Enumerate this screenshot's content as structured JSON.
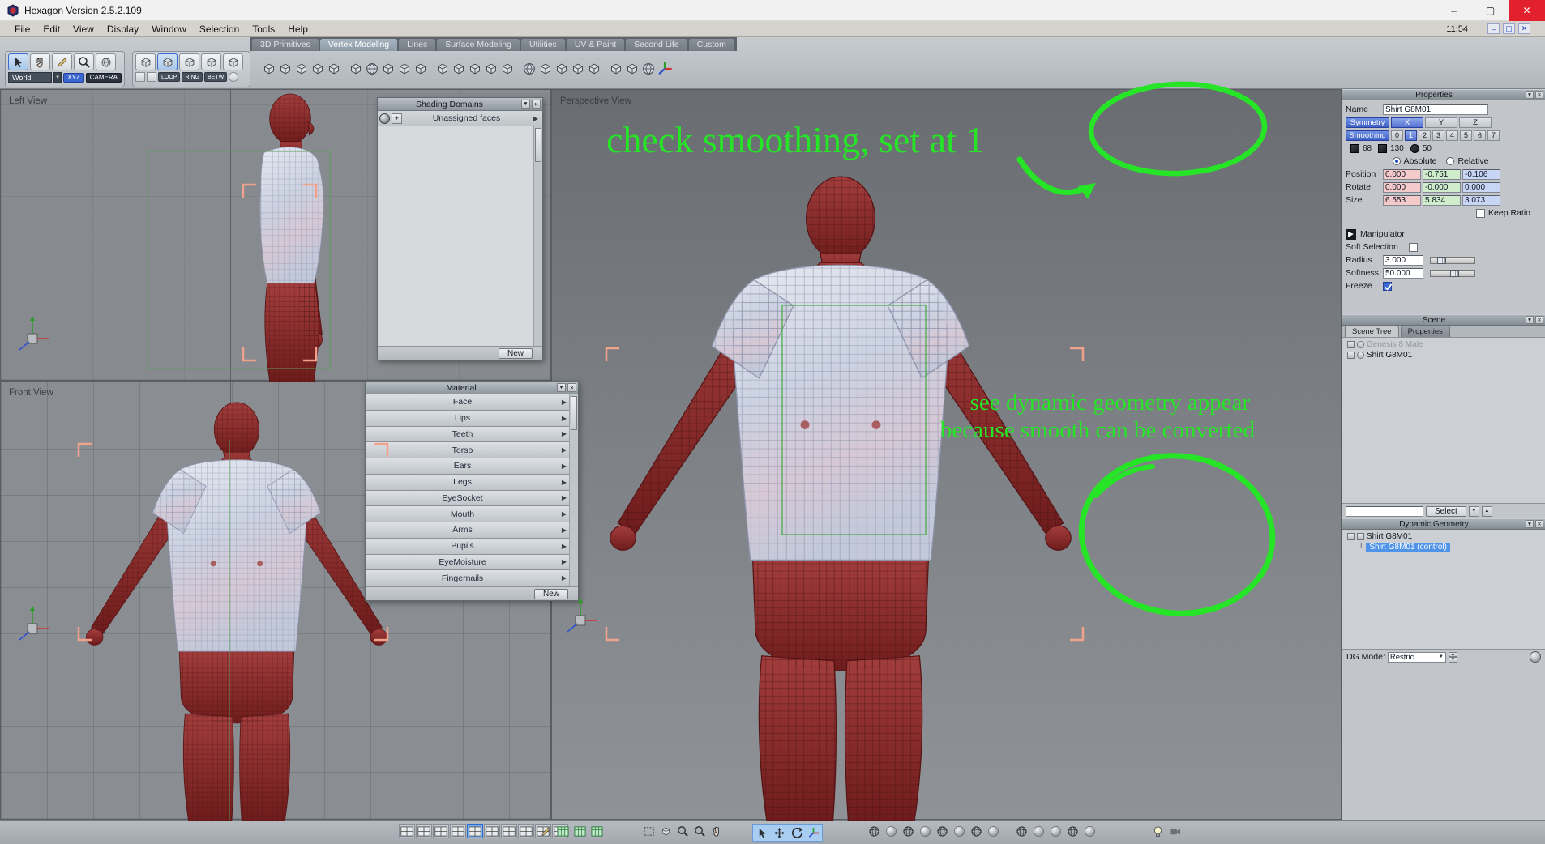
{
  "window": {
    "title": "Hexagon Version 2.5.2.109"
  },
  "window_controls": {
    "minimize": "–",
    "maximize": "▢",
    "close": "✕"
  },
  "icons": {
    "close": "✕",
    "down": "▼",
    "up": "▲",
    "chevron": "▶",
    "plus": "+",
    "branch": "└"
  },
  "menubar": {
    "items": [
      "File",
      "Edit",
      "View",
      "Display",
      "Window",
      "Selection",
      "Tools",
      "Help"
    ],
    "time": "11:54"
  },
  "tabs": {
    "items": [
      "3D Primitives",
      "Vertex Modeling",
      "Lines",
      "Surface Modeling",
      "Utilities",
      "UV & Paint",
      "Second Life",
      "Custom"
    ]
  },
  "tools_left": {
    "world": "World",
    "xyz": "XYZ",
    "camera": "CAMERA"
  },
  "selection_tools": {
    "loop": "LOOP",
    "ring": "RING",
    "betw": "BETW"
  },
  "viewports": {
    "left": "Left View",
    "front": "Front View",
    "perspective": "Perspective View"
  },
  "shading_domains": {
    "title": "Shading Domains",
    "item": "Unassigned faces",
    "new_label": "New"
  },
  "material": {
    "title": "Material",
    "items": [
      "Face",
      "Lips",
      "Teeth",
      "Torso",
      "Ears",
      "Legs",
      "EyeSocket",
      "Mouth",
      "Arms",
      "Pupils",
      "EyeMoisture",
      "Fingernails"
    ],
    "new_label": "New"
  },
  "properties": {
    "title": "Properties",
    "name_label": "Name",
    "name_value": "Shirt G8M01",
    "symmetry_label": "Symmetry",
    "axis_x": "X",
    "axis_y": "Y",
    "axis_z": "Z",
    "smoothing_label": "Smoothing",
    "levels": [
      "0",
      "1",
      "2",
      "3",
      "4",
      "5",
      "6",
      "7"
    ],
    "vertex_count": "68",
    "edge_count": "130",
    "face_count": "50",
    "absolute_label": "Absolute",
    "relative_label": "Relative",
    "position_label": "Position",
    "position": [
      "0.000",
      "-0.751",
      "-0.106"
    ],
    "rotate_label": "Rotate",
    "rotate": [
      "0.000",
      "-0.000",
      "0.000"
    ],
    "size_label": "Size",
    "size": [
      "6.553",
      "5.834",
      "3.073"
    ],
    "keep_ratio_label": "Keep Ratio",
    "manipulator_label": "Manipulator",
    "soft_selection_label": "Soft Selection",
    "radius_label": "Radius",
    "radius_value": "3.000",
    "softness_label": "Softness",
    "softness_value": "50.000",
    "freeze_label": "Freeze"
  },
  "scene": {
    "title": "Scene",
    "tab_tree": "Scene Tree",
    "tab_props": "Properties",
    "items": [
      "Genesis 8 Male",
      "Shirt G8M01"
    ]
  },
  "selector": {
    "button": "Select"
  },
  "dynamic_geometry": {
    "title": "Dynamic Geometry",
    "root": "Shirt G8M01",
    "child": "Shirt G8M01 (control)"
  },
  "dg_mode": {
    "label": "DG Mode:",
    "value": "Restric..."
  },
  "annotations": {
    "smoothing_note": "check smoothing, set at 1",
    "dg_note_line1": "see dynamic geometry appear",
    "dg_note_line2": "because smooth can be converted",
    "color": "#26e426"
  }
}
